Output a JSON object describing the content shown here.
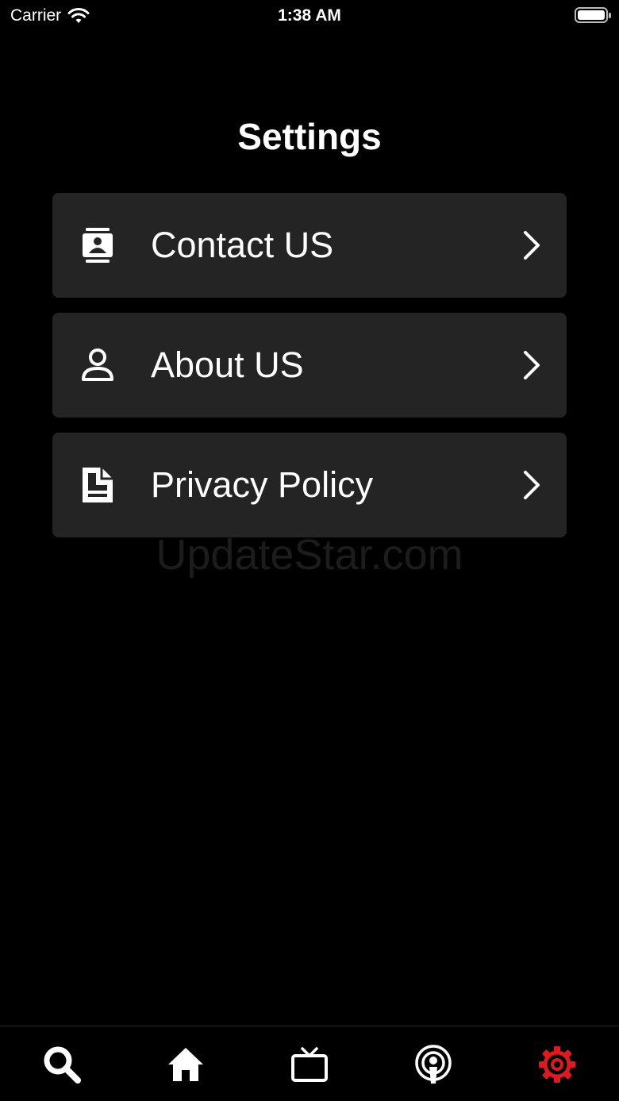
{
  "status_bar": {
    "carrier": "Carrier",
    "time": "1:38 AM"
  },
  "header": {
    "title": "Settings"
  },
  "settings": {
    "items": [
      {
        "label": "Contact US",
        "icon": "contact-card-icon"
      },
      {
        "label": "About US",
        "icon": "person-icon"
      },
      {
        "label": "Privacy Policy",
        "icon": "document-icon"
      }
    ]
  },
  "watermark": "UpdateStar.com",
  "tab_bar": {
    "tabs": [
      {
        "icon": "search-icon",
        "active": false
      },
      {
        "icon": "home-icon",
        "active": false
      },
      {
        "icon": "tv-icon",
        "active": false
      },
      {
        "icon": "podcast-icon",
        "active": false
      },
      {
        "icon": "gear-icon",
        "active": true
      }
    ],
    "active_color": "#e0191f",
    "inactive_color": "#ffffff"
  },
  "colors": {
    "background": "#000000",
    "row_background": "#242424"
  }
}
